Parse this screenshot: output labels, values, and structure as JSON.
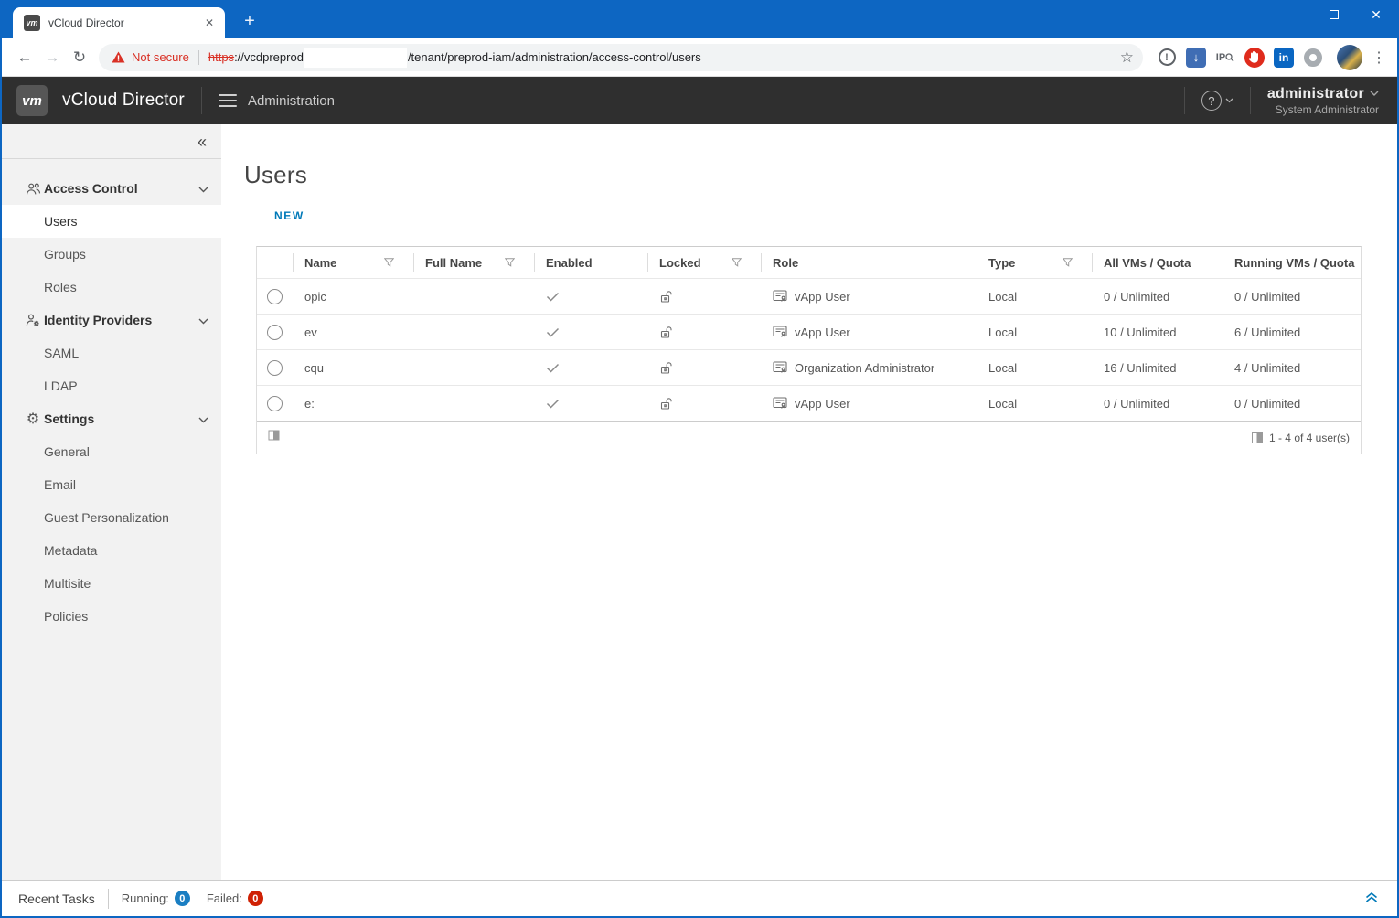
{
  "window": {
    "tab_title": "vCloud Director",
    "controls": {
      "minimize": "–",
      "close": "✕"
    }
  },
  "browser": {
    "security_label": "Not secure",
    "url_protocol": "https",
    "url_host": "://vcdpreprod",
    "url_path": "/tenant/preprod-iam/administration/access-control/users"
  },
  "icons": {
    "favicon": "vm",
    "tab_close": "✕",
    "new_tab": "+",
    "back_arrow": "←",
    "forward_arrow": "→",
    "reload": "↻",
    "star": "☆",
    "overflow_menu": "⋮",
    "info_extension": "!",
    "download_extension_arrow": "↓",
    "ip_extension": "IP",
    "linkedin_extension": "in",
    "collapse_sidebar": "«",
    "help": "?",
    "settings_gear": "⚙"
  },
  "header": {
    "logo_text": "vm",
    "product": "vCloud Director",
    "nav_section": "Administration",
    "user_name": "administrator",
    "user_role": "System Administrator"
  },
  "sidebar": {
    "sections": [
      {
        "label": "Access Control",
        "icon": "users-group-icon",
        "children": [
          "Users",
          "Groups",
          "Roles"
        ],
        "selected": "Users"
      },
      {
        "label": "Identity Providers",
        "icon": "user-gear-icon",
        "children": [
          "SAML",
          "LDAP"
        ]
      },
      {
        "label": "Settings",
        "icon": "gear-icon",
        "children": [
          "General",
          "Email",
          "Guest Personalization",
          "Metadata",
          "Multisite",
          "Policies"
        ]
      }
    ]
  },
  "main": {
    "title": "Users",
    "new_button": "NEW",
    "table": {
      "columns": [
        "Name",
        "Full Name",
        "Enabled",
        "Locked",
        "Role",
        "Type",
        "All VMs / Quota",
        "Running VMs / Quota"
      ],
      "filterable_columns": [
        "Name",
        "Full Name",
        "Locked",
        "Type"
      ],
      "rows": [
        {
          "name": "opic",
          "full_name": "",
          "enabled": true,
          "locked": false,
          "role": "vApp User",
          "type": "Local",
          "all_vms": "0 / Unlimited",
          "running_vms": "0 / Unlimited"
        },
        {
          "name": "ev",
          "full_name": "",
          "enabled": true,
          "locked": false,
          "role": "vApp User",
          "type": "Local",
          "all_vms": "10 / Unlimited",
          "running_vms": "6 / Unlimited"
        },
        {
          "name": "cqu",
          "full_name": "",
          "enabled": true,
          "locked": false,
          "role": "Organization Administrator",
          "type": "Local",
          "all_vms": "16 / Unlimited",
          "running_vms": "4 / Unlimited"
        },
        {
          "name": "e:",
          "full_name": "",
          "enabled": true,
          "locked": false,
          "role": "vApp User",
          "type": "Local",
          "all_vms": "0 / Unlimited",
          "running_vms": "0 / Unlimited"
        }
      ],
      "pagination": "1 - 4 of 4 user(s)"
    }
  },
  "statusbar": {
    "recent_tasks": "Recent Tasks",
    "running_label": "Running:",
    "running_count": "0",
    "failed_label": "Failed:",
    "failed_count": "0"
  },
  "colors": {
    "titlebar_blue": "#0d66c2",
    "header_dark": "#2f2f2f",
    "accent_blue": "#0079b8",
    "running_badge": "#1a7ec2",
    "failed_badge": "#cf2104",
    "not_secure_red": "#d93025"
  }
}
